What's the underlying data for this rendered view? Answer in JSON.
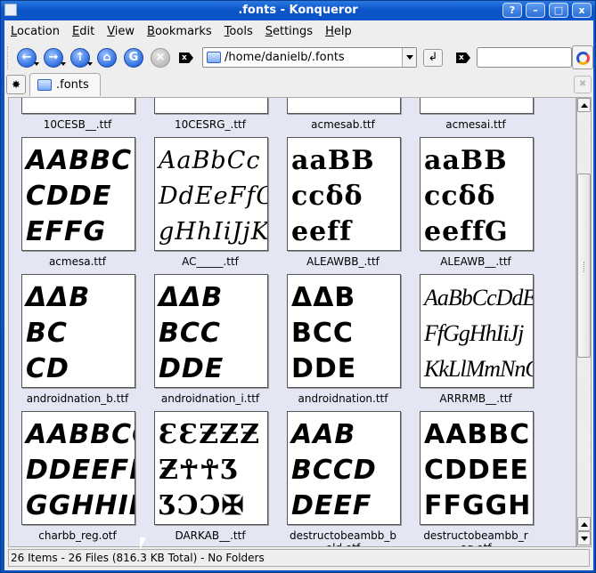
{
  "window": {
    "title": ".fonts - Konqueror",
    "buttons": {
      "help": "?",
      "minimize": "–",
      "maximize": "□",
      "close": "x"
    }
  },
  "menubar": {
    "items": [
      {
        "label": "Location",
        "mnemonic": "L"
      },
      {
        "label": "Edit",
        "mnemonic": "E"
      },
      {
        "label": "View",
        "mnemonic": "V"
      },
      {
        "label": "Bookmarks",
        "mnemonic": "B"
      },
      {
        "label": "Tools",
        "mnemonic": "T"
      },
      {
        "label": "Settings",
        "mnemonic": "S"
      },
      {
        "label": "Help",
        "mnemonic": "H"
      }
    ]
  },
  "toolbar": {
    "back_icon": "arrow-left-icon",
    "forward_icon": "arrow-right-icon",
    "up_icon": "arrow-up-icon",
    "home_icon": "home-icon",
    "reload_icon": "reload-icon",
    "stop_icon": "stop-icon",
    "location_value": "/home/danielb/.fonts",
    "search_value": "",
    "go_glyph": "↲"
  },
  "tabs": [
    {
      "label": ".fonts",
      "active": true
    }
  ],
  "files": [
    {
      "name": "10CESB__.ttf",
      "sample": "",
      "style": ""
    },
    {
      "name": "10CESRG_.ttf",
      "sample": "",
      "style": ""
    },
    {
      "name": "acmesab.ttf",
      "sample": "",
      "style": ""
    },
    {
      "name": "acmesai.ttf",
      "sample": "",
      "style": ""
    },
    {
      "name": "acmesa.ttf",
      "sample": "AABBC\nCDDE\nEFFG",
      "style": "f-italic"
    },
    {
      "name": "AC_____.ttf",
      "sample": "AaBbCc\nDdEeFfG\ngHhIiJjK",
      "style": "f-serif"
    },
    {
      "name": "ALEAWBB_.ttf",
      "sample": "aaBB\nccδδ\neeff",
      "style": "f-cursive"
    },
    {
      "name": "ALEAWB__.ttf",
      "sample": "aaBB\nccδδ\neeffG",
      "style": "f-cursive"
    },
    {
      "name": "androidnation_b.ttf",
      "sample": "ΔΔB\nBC\nCD",
      "style": "f-italic"
    },
    {
      "name": "androidnation_i.ttf",
      "sample": "ΔΔB\nBCC\nDDE",
      "style": "f-italic"
    },
    {
      "name": "androidnation.ttf",
      "sample": "ΔΔB\nBCC\nDDE",
      "style": ""
    },
    {
      "name": "ARRRMB__.ttf",
      "sample": "AaBbCcDdEe\nFfGgHhIiJj\nKkLlMmNnO",
      "style": "f-narrow"
    },
    {
      "name": "charbb_reg.otf",
      "sample": "AABBCC\nDDEEFF\nGGHHIIJJ",
      "style": "f-italic"
    },
    {
      "name": "DARKAB__.ttf",
      "sample": "ƐƐƵƵƵ\nƵ☥☥Ʒ\nƷƆƆ✠",
      "style": "f-cursive"
    },
    {
      "name": "destructobeambb_bold.otf",
      "sample": "AAB\nBCCD\nDEEF",
      "style": "f-italic"
    },
    {
      "name": "destructobeambb_reg.otf",
      "sample": "AABBC\nCDDEE\nFFGGH",
      "style": ""
    }
  ],
  "status": {
    "text": "26 Items - 26 Files (816.3 KB Total) - No Folders"
  },
  "scroll": {
    "vertical_position_fraction": 0.2
  }
}
